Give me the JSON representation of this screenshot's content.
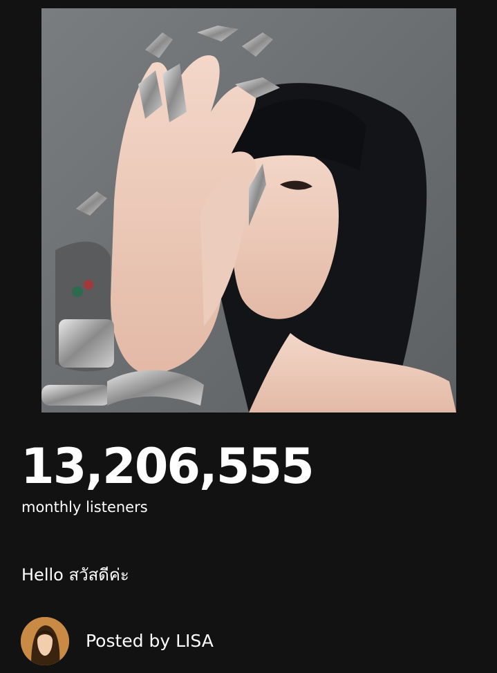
{
  "artist": {
    "photo_alt": "Artist photo"
  },
  "stats": {
    "monthly_listeners": "13,206,555",
    "monthly_listeners_label": "monthly listeners"
  },
  "post": {
    "text": "Hello สวัสดีค่ะ",
    "posted_by": "Posted by LISA"
  },
  "colors": {
    "background": "#121212",
    "text": "#ffffff"
  }
}
